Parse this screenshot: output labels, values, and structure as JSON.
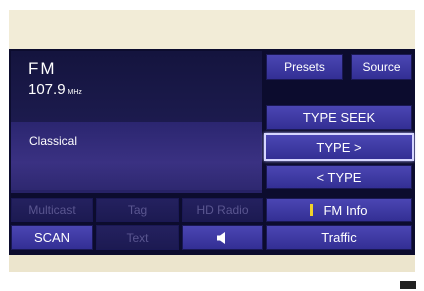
{
  "station": {
    "band": "FM",
    "frequency": "107.9",
    "unit": "MHz",
    "genre": "Classical"
  },
  "top_buttons": {
    "presets": "Presets",
    "source": "Source"
  },
  "type_controls": {
    "type_seek": "TYPE SEEK",
    "type_next": "TYPE >",
    "type_prev": "< TYPE"
  },
  "bottom_row1": {
    "multicast": "Multicast",
    "tag": "Tag",
    "hd_radio": "HD Radio",
    "fm_info": "FM Info"
  },
  "bottom_row2": {
    "scan": "SCAN",
    "text": "Text",
    "traffic": "Traffic"
  },
  "icons": {
    "speaker": "speaker-icon",
    "info_marker": "status-marker-icon"
  },
  "colors": {
    "button": "#3a36a0",
    "button_dim": "#201d58",
    "screen": "#0c0c2e",
    "marker": "#f0d22a"
  }
}
